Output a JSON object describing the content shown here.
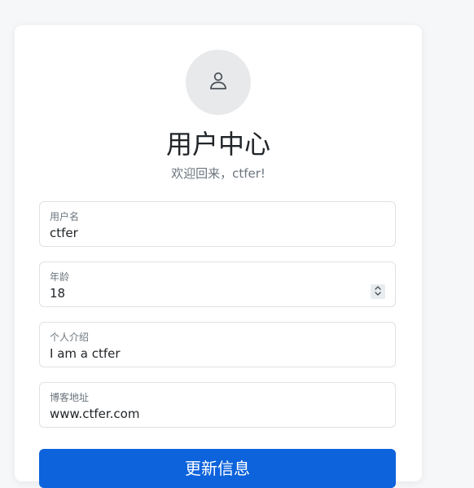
{
  "profile": {
    "avatar_icon": "user-icon",
    "title": "用户中心",
    "welcome": "欢迎回来，ctfer!"
  },
  "form": {
    "username": {
      "label": "用户名",
      "value": "ctfer"
    },
    "age": {
      "label": "年龄",
      "value": "18"
    },
    "bio": {
      "label": "个人介绍",
      "value": "I am a ctfer"
    },
    "blog": {
      "label": "博客地址",
      "value": "www.ctfer.com"
    },
    "submit_label": "更新信息"
  },
  "colors": {
    "primary": "#0d63dc",
    "background": "#f6f7f9",
    "avatar_bg": "#e8e9eb"
  }
}
